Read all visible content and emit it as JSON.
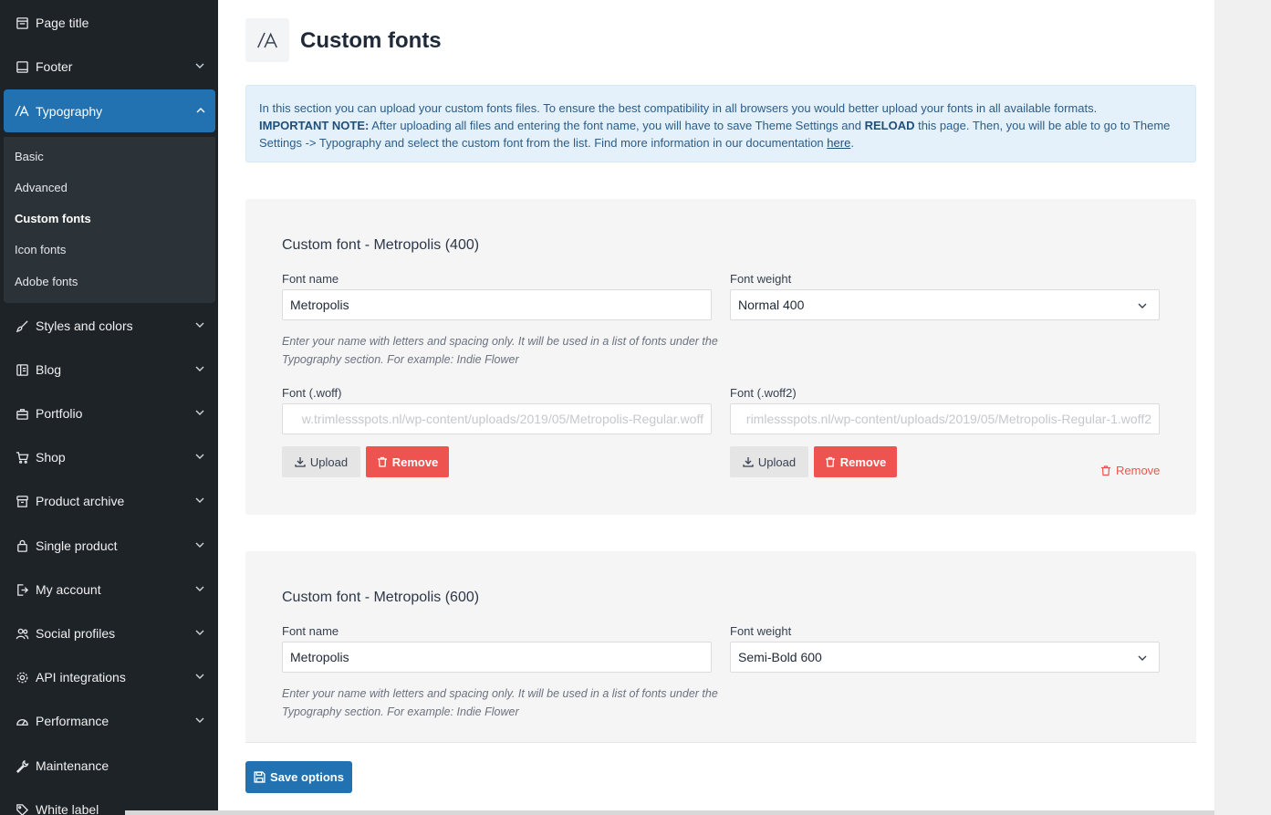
{
  "sidebar": {
    "items": [
      {
        "label": "Page title",
        "icon": "page-icon",
        "chevron": false
      },
      {
        "label": "Footer",
        "icon": "footer-icon",
        "chevron": true
      },
      {
        "label": "Typography",
        "icon": "typography-icon",
        "chevron": true
      },
      {
        "label": "Styles and colors",
        "icon": "brush-icon",
        "chevron": true
      },
      {
        "label": "Blog",
        "icon": "blog-icon",
        "chevron": true
      },
      {
        "label": "Portfolio",
        "icon": "briefcase-icon",
        "chevron": true
      },
      {
        "label": "Shop",
        "icon": "cart-icon",
        "chevron": true
      },
      {
        "label": "Product archive",
        "icon": "archive-icon",
        "chevron": true
      },
      {
        "label": "Single product",
        "icon": "bag-icon",
        "chevron": true
      },
      {
        "label": "My account",
        "icon": "login-icon",
        "chevron": true
      },
      {
        "label": "Social profiles",
        "icon": "users-icon",
        "chevron": true
      },
      {
        "label": "API integrations",
        "icon": "gear-icon",
        "chevron": true
      },
      {
        "label": "Performance",
        "icon": "gauge-icon",
        "chevron": true
      },
      {
        "label": "Maintenance",
        "icon": "wrench-icon",
        "chevron": false
      },
      {
        "label": "White label",
        "icon": "tag-icon",
        "chevron": false
      }
    ],
    "submenu": [
      "Basic",
      "Advanced",
      "Custom fonts",
      "Icon fonts",
      "Adobe fonts"
    ]
  },
  "page": {
    "title": "Custom fonts",
    "notice": {
      "line1": "In this section you can upload your custom fonts files. To ensure the best compatibility in all browsers you would better upload your fonts in all available formats.",
      "important": "IMPORTANT NOTE:",
      "line2a": " After uploading all files and entering the font name, you will have to save Theme Settings and ",
      "reload": "RELOAD",
      "line2b": " this page. Then, you will be able to go to Theme Settings -> Typography and select the custom font from the list. Find more information in our documentation ",
      "link": "here",
      "end": "."
    }
  },
  "cards": [
    {
      "title": "Custom font - Metropolis (400)",
      "font_name_label": "Font name",
      "font_name_value": "Metropolis",
      "font_weight_label": "Font weight",
      "font_weight_value": "Normal 400",
      "hint": "Enter your name with letters and spacing only. It will be used in a list of fonts under the Typography section. For example: Indie Flower",
      "woff_label": "Font (.woff)",
      "woff_value": "w.trimlessspots.nl/wp-content/uploads/2019/05/Metropolis-Regular.woff",
      "woff2_label": "Font (.woff2)",
      "woff2_value": "rimlessspots.nl/wp-content/uploads/2019/05/Metropolis-Regular-1.woff2",
      "upload_label": "Upload",
      "remove_label": "Remove",
      "remove_font_label": "Remove"
    },
    {
      "title": "Custom font - Metropolis (600)",
      "font_name_label": "Font name",
      "font_name_value": "Metropolis",
      "font_weight_label": "Font weight",
      "font_weight_value": "Semi-Bold 600",
      "hint": "Enter your name with letters and spacing only. It will be used in a list of fonts under the Typography section. For example: Indie Flower"
    }
  ],
  "save_label": "Save options",
  "colors": {
    "sidebar_bg": "#1d2327",
    "accent": "#2271b1",
    "danger": "#ef5350",
    "notice_bg": "#e5f1fa"
  }
}
